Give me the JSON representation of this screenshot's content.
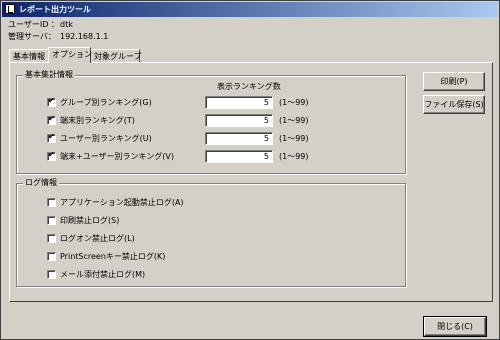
{
  "window": {
    "title": "レポート出力ツール"
  },
  "info": {
    "user_label": "ユーザーID ：",
    "user_value": "dtk",
    "server_label": "管理サーバ：",
    "server_value": "192.168.1.1"
  },
  "tabs": [
    {
      "label": "基本情報",
      "active": false
    },
    {
      "label": "オプション",
      "active": true
    },
    {
      "label": "対象グループ",
      "active": false
    }
  ],
  "summary": {
    "title": "基本集計情報",
    "column_header": "表示ランキング数",
    "rows": [
      {
        "label": "グループ別ランキング(G)",
        "checked": true,
        "value": "5",
        "range": "(1〜99)"
      },
      {
        "label": "端末別ランキング(T)",
        "checked": true,
        "value": "5",
        "range": "(1〜99)"
      },
      {
        "label": "ユーザー別ランキング(U)",
        "checked": true,
        "value": "5",
        "range": "(1〜99)"
      },
      {
        "label": "端末+ユーザー別ランキング(V)",
        "checked": true,
        "value": "5",
        "range": "(1〜99)"
      }
    ]
  },
  "log": {
    "title": "ログ情報",
    "rows": [
      {
        "label": "アプリケーション起動禁止ログ(A)",
        "checked": false
      },
      {
        "label": "印刷禁止ログ(S)",
        "checked": false
      },
      {
        "label": "ログオン禁止ログ(L)",
        "checked": false
      },
      {
        "label": "PrintScreenキー禁止ログ(K)",
        "checked": false
      },
      {
        "label": "メール添付禁止ログ(M)",
        "checked": false
      }
    ]
  },
  "buttons": {
    "print": "印刷(P)",
    "save": "ファイル保存(S)",
    "close": "閉じる(C)"
  }
}
